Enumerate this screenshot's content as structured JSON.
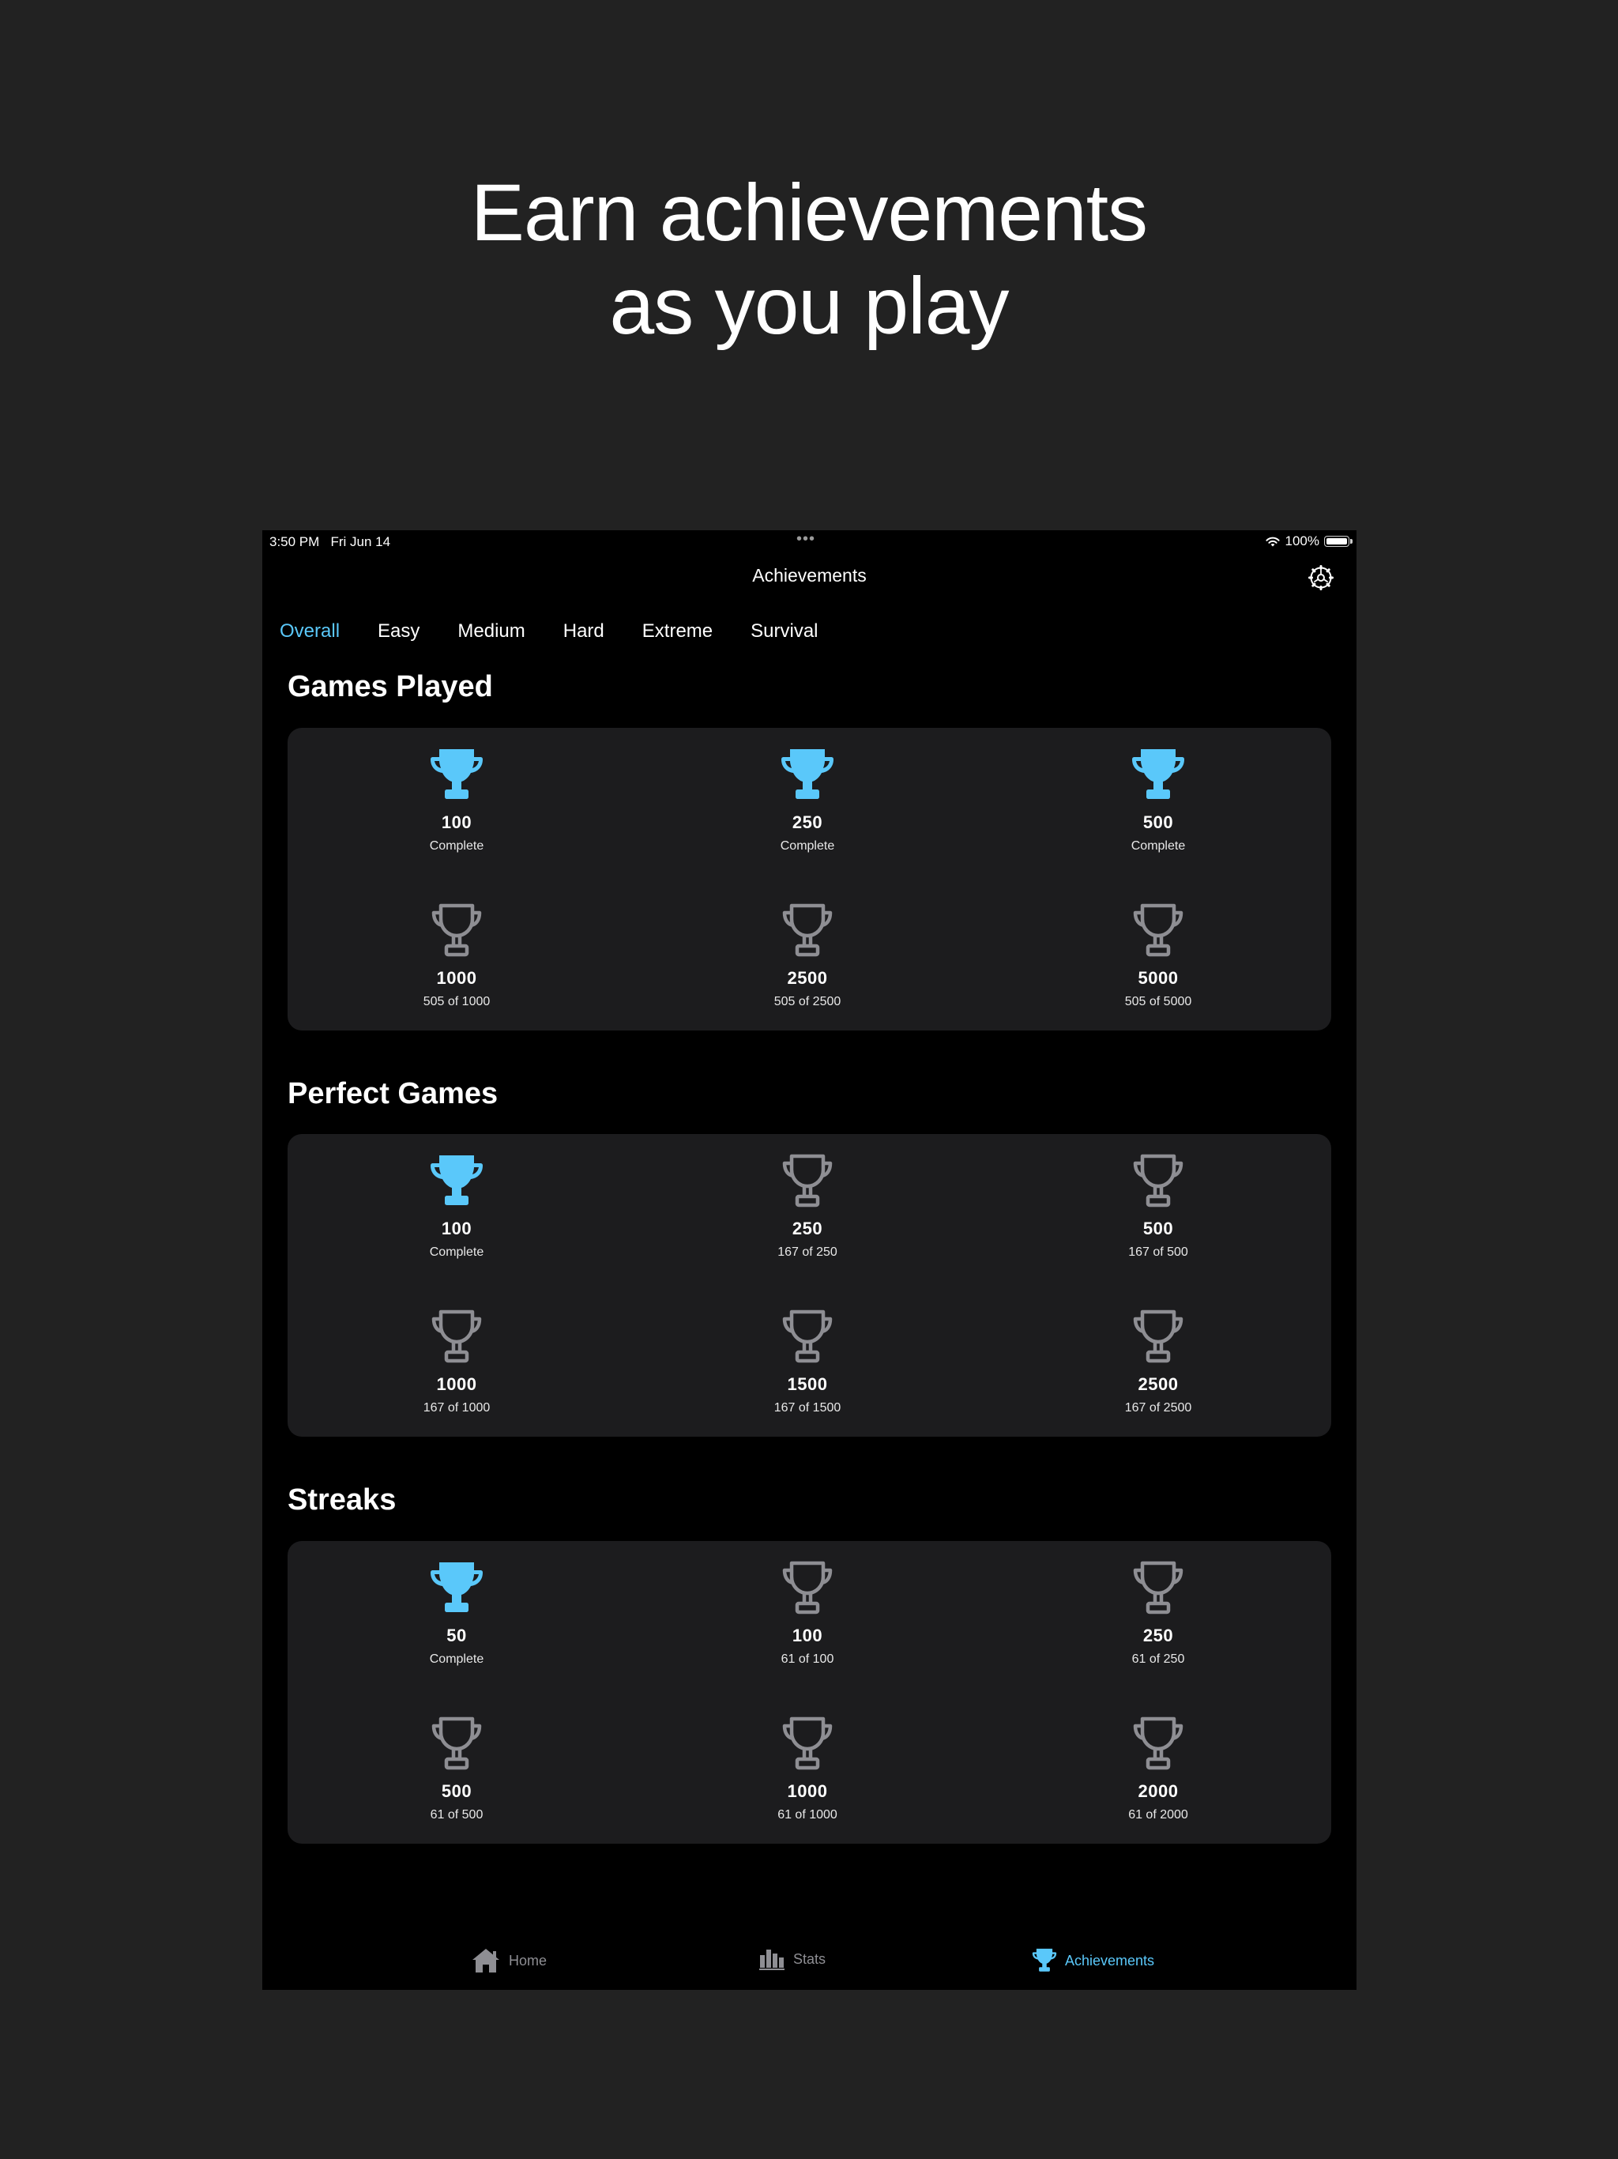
{
  "headline": {
    "line1": "Earn achievements",
    "line2": "as you play"
  },
  "status_bar": {
    "time": "3:50 PM",
    "date": "Fri Jun 14",
    "dots": "•••",
    "battery": "100%"
  },
  "nav": {
    "title": "Achievements"
  },
  "tabs": [
    {
      "label": "Overall",
      "active": true
    },
    {
      "label": "Easy"
    },
    {
      "label": "Medium"
    },
    {
      "label": "Hard"
    },
    {
      "label": "Extreme"
    },
    {
      "label": "Survival"
    }
  ],
  "sections": [
    {
      "title": "Games Played",
      "items": [
        {
          "value": "100",
          "status": "Complete",
          "earned": true
        },
        {
          "value": "250",
          "status": "Complete",
          "earned": true
        },
        {
          "value": "500",
          "status": "Complete",
          "earned": true
        },
        {
          "value": "1000",
          "status": "505 of 1000",
          "earned": false
        },
        {
          "value": "2500",
          "status": "505 of 2500",
          "earned": false
        },
        {
          "value": "5000",
          "status": "505 of 5000",
          "earned": false
        }
      ]
    },
    {
      "title": "Perfect Games",
      "items": [
        {
          "value": "100",
          "status": "Complete",
          "earned": true
        },
        {
          "value": "250",
          "status": "167 of 250",
          "earned": false
        },
        {
          "value": "500",
          "status": "167 of 500",
          "earned": false
        },
        {
          "value": "1000",
          "status": "167 of 1000",
          "earned": false
        },
        {
          "value": "1500",
          "status": "167 of 1500",
          "earned": false
        },
        {
          "value": "2500",
          "status": "167 of 2500",
          "earned": false
        }
      ]
    },
    {
      "title": "Streaks",
      "items": [
        {
          "value": "50",
          "status": "Complete",
          "earned": true
        },
        {
          "value": "100",
          "status": "61 of 100",
          "earned": false
        },
        {
          "value": "250",
          "status": "61 of 250",
          "earned": false
        },
        {
          "value": "500",
          "status": "61 of 500",
          "earned": false
        },
        {
          "value": "1000",
          "status": "61 of 1000",
          "earned": false
        },
        {
          "value": "2000",
          "status": "61 of 2000",
          "earned": false
        }
      ]
    }
  ],
  "tab_bar": [
    {
      "label": "Home",
      "icon": "house-icon",
      "active": false
    },
    {
      "label": "Stats",
      "icon": "bar-chart-icon",
      "active": false
    },
    {
      "label": "Achievements",
      "icon": "trophy-icon",
      "active": true
    }
  ],
  "colors": {
    "accent": "#5ac8fa",
    "locked": "#8e8e93",
    "card": "#1c1c1e"
  }
}
